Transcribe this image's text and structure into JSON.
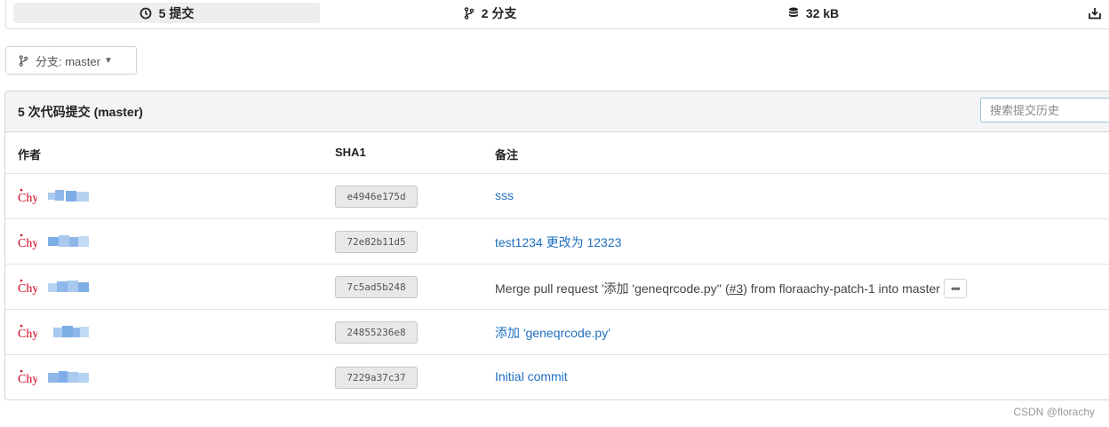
{
  "stats": {
    "commits": "5 提交",
    "branches": "2 分支",
    "size": "32 kB"
  },
  "branch_selector": {
    "label": "分支: master"
  },
  "commits_panel": {
    "title": "5 次代码提交 (master)",
    "search_placeholder": "搜索提交历史",
    "columns": {
      "author": "作者",
      "sha": "SHA1",
      "message": "备注"
    },
    "rows": [
      {
        "avatar": "Chy",
        "sha": "e4946e175d",
        "message": "sss"
      },
      {
        "avatar": "Chy",
        "sha": "72e82b11d5",
        "message": "test1234 更改为 12323"
      },
      {
        "avatar": "Chy",
        "sha": "7c5ad5b248",
        "message_prefix": "Merge pull request '添加 'geneqrcode.py'' (",
        "message_issue": "#3",
        "message_suffix": ") from floraachy-patch-1 into master"
      },
      {
        "avatar": "Chy",
        "sha": "24855236e8",
        "message": "添加 'geneqrcode.py'"
      },
      {
        "avatar": "Chy",
        "sha": "7229a37c37",
        "message": "Initial commit"
      }
    ]
  },
  "watermark": "CSDN @florachy",
  "colors": {
    "link": "#1e70bf",
    "avatar_red": "#d0021b",
    "blur_blue": "#8fb8e8"
  }
}
